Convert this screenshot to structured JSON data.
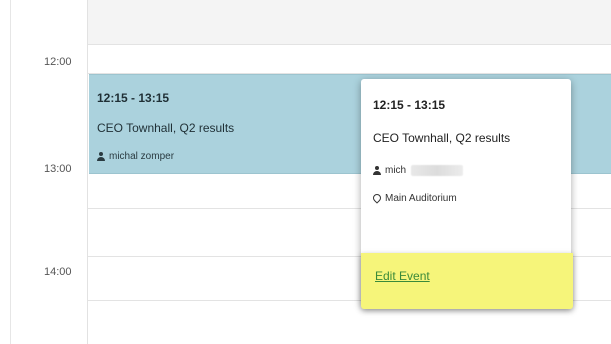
{
  "calendar": {
    "time_labels": [
      "12:00",
      "13:00",
      "14:00"
    ]
  },
  "event": {
    "time": "12:15 - 13:15",
    "title": "CEO Townhall, Q2 results",
    "owner": "michal zomper",
    "color": "#abd2dd"
  },
  "popup": {
    "time": "12:15 - 13:15",
    "title": "CEO Townhall, Q2 results",
    "owner_visible": "mich",
    "location": "Main Auditorium",
    "edit_link_label": "Edit Event",
    "highlight_color": "#f6f57a",
    "link_color": "#3a8a3a"
  },
  "icons": {
    "owner": "person-icon",
    "location": "map-pin-icon"
  }
}
